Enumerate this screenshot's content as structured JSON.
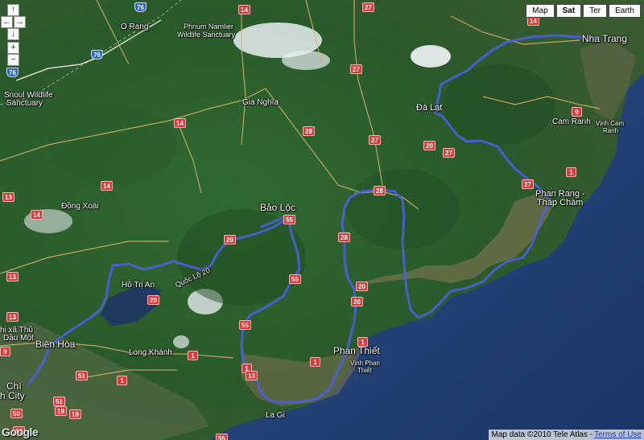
{
  "map_type_buttons": [
    {
      "label": "Map",
      "active": false
    },
    {
      "label": "Sat",
      "active": true
    },
    {
      "label": "Ter",
      "active": false
    },
    {
      "label": "Earth",
      "active": false
    }
  ],
  "controls": {
    "pan_up": "↑",
    "pan_left": "←",
    "pan_right": "→",
    "pan_down": "↓",
    "zoom_in": "+",
    "zoom_out": "−"
  },
  "place_labels": {
    "nha_trang": "Nha Trang",
    "da_lat": "Đà Lạt",
    "cam_ranh": "Cam Ranh",
    "vinh_cam_ranh_1": "Vịnh Cam",
    "vinh_cam_ranh_2": "Ranh",
    "phan_rang_1": "Phan Rang -",
    "phan_rang_2": "Tháp Chàm",
    "bao_loc": "Bảo Lộc",
    "gia_nghia": "Gia Nghĩa",
    "o_rang": "O Rang",
    "phnum_1": "Phnum Namlier",
    "phnum_2": "Wildlife Sanctuary",
    "snoul_1": "Snoul Wildlife",
    "snoul_2": "Sanctuary",
    "dong_xoai": "Đồng Xoài",
    "ho_tri_an": "Hồ Trị An",
    "quoc_lo_20": "Quốc Lộ 20",
    "thi_xa_thu_1": "hị xã Thủ",
    "thi_xa_thu_2": "Dầu Một",
    "bien_hoa": "Biên Hòa",
    "long_khanh": "Long Khánh",
    "phan_thiet": "Phan Thiết",
    "vinh_phan_thiet_1": "Vịnh Phan",
    "vinh_phan_thiet_2": "Thiết",
    "la_gi": "La Gi",
    "chi_1": "Chí",
    "chi_2": "h City"
  },
  "road_shields": {
    "r76_a": "76",
    "r76_b": "76",
    "r76_c": "76",
    "r14_a": "14",
    "r14_b": "14",
    "r14_c": "14",
    "r14_d": "14",
    "r14_e": "14",
    "r27_a": "27",
    "r27_b": "27",
    "r27_c": "27",
    "r27_d": "27",
    "r27_e": "27",
    "r28": "28",
    "r20_a": "20",
    "r20_b": "20",
    "r20_c": "20",
    "r20_d": "20",
    "r20_e": "20",
    "r55_a": "55",
    "r55_b": "55",
    "r55_c": "55",
    "r1_a": "1",
    "r1_b": "1",
    "r1_c": "1",
    "r1_d": "1",
    "r1_e": "1",
    "r1_f": "1",
    "r9_a": "9",
    "r9_b": "9",
    "r13_a": "13",
    "r13_b": "13",
    "r13_c": "13",
    "r13_d": "13",
    "r13_e": "13",
    "r51_a": "51",
    "r51_b": "51",
    "r50": "50",
    "r19_a": "19",
    "r19_b": "19",
    "r55_d": "55",
    "r28_b": "28",
    "r28_c": "28"
  },
  "footer": {
    "attribution": "Map data ©2010 Tele Atlas -",
    "terms_link": "Terms of Use"
  },
  "logo": "Google",
  "colors": {
    "route": "#4a5fe0",
    "road_major": "#e9e5d0",
    "road_minor": "#d7b36a",
    "sea": "#203d70",
    "land": "#2e6330"
  }
}
